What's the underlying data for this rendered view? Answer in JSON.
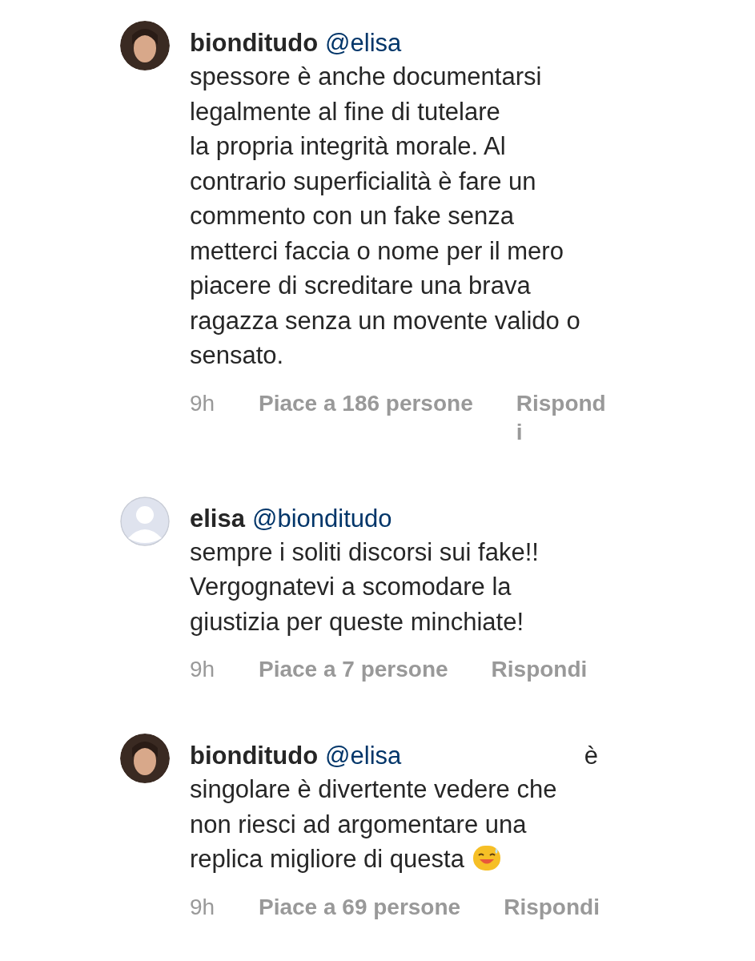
{
  "comments": [
    {
      "username": "bionditudo",
      "mention": "@elisa",
      "lines": [
        "spessore è anche documentarsi",
        "legalmente al fine di tutelare",
        "la propria integrità morale. Al",
        "contrario superficialità è fare un",
        "commento con un fake senza",
        "metterci faccia o nome per il mero",
        "piacere di screditare una brava",
        "ragazza senza un movente valido o",
        "sensato."
      ],
      "time": "9h",
      "likes": "Piace a 186 persone",
      "reply": "Rispondi"
    },
    {
      "avatar": {
        "kind": "default"
      },
      "username": "elisa",
      "mention": "@bionditudo",
      "lines": [
        "sempre i soliti discorsi sui fake!!",
        "Vergognatevi a scomodare la",
        "giustizia per queste minchiate!"
      ],
      "time": "9h",
      "likes": "Piace a 7 persone",
      "reply": "Rispondi"
    },
    {
      "username": "bionditudo",
      "mention": "@elisa",
      "trailing": "è",
      "lines": [
        "singolare è divertente vedere che",
        "non riesci ad argomentare una",
        "replica migliore di questa"
      ],
      "emoji": true,
      "time": "9h",
      "likes": "Piace a 69 persone",
      "reply": "Rispondi"
    }
  ]
}
